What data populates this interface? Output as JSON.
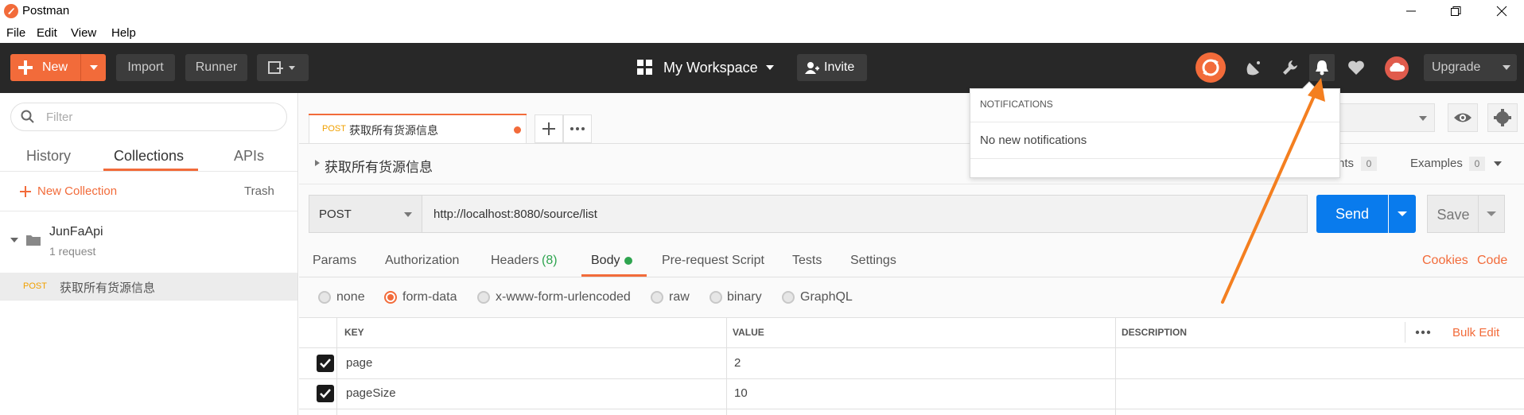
{
  "window": {
    "title": "Postman"
  },
  "menu": [
    "File",
    "Edit",
    "View",
    "Help"
  ],
  "header": {
    "new_label": "New",
    "import_label": "Import",
    "runner_label": "Runner",
    "workspace_label": "My Workspace",
    "invite_label": "Invite",
    "upgrade_label": "Upgrade"
  },
  "sidebar": {
    "filter_placeholder": "Filter",
    "tabs": [
      "History",
      "Collections",
      "APIs"
    ],
    "new_collection_label": "New Collection",
    "trash_label": "Trash",
    "collection": {
      "name": "JunFaApi",
      "count": "1 request"
    },
    "request": {
      "method": "POST",
      "name": "获取所有货源信息"
    }
  },
  "request_tab": {
    "method": "POST",
    "name": "获取所有货源信息"
  },
  "request": {
    "title": "获取所有货源信息",
    "comments_partial": "nts",
    "comments_count": "0",
    "examples_label": "Examples",
    "examples_count": "0",
    "method": "POST",
    "url": "http://localhost:8080/source/list",
    "send_label": "Send",
    "save_label": "Save"
  },
  "subtabs": {
    "params": "Params",
    "authorization": "Authorization",
    "headers": "Headers",
    "headers_count": "(8)",
    "body": "Body",
    "prerequest": "Pre-request Script",
    "tests": "Tests",
    "settings": "Settings",
    "cookies": "Cookies",
    "code": "Code"
  },
  "body_types": [
    "none",
    "form-data",
    "x-www-form-urlencoded",
    "raw",
    "binary",
    "GraphQL"
  ],
  "table": {
    "headers": {
      "key": "KEY",
      "value": "VALUE",
      "description": "DESCRIPTION",
      "bulk_edit": "Bulk Edit"
    },
    "rows": [
      {
        "key": "page",
        "value": "2",
        "checked": true
      },
      {
        "key": "pageSize",
        "value": "10",
        "checked": true
      }
    ]
  },
  "notifications": {
    "title": "NOTIFICATIONS",
    "empty": "No new notifications"
  },
  "colors": {
    "accent": "#f26b3a",
    "send_blue": "#097bed",
    "header_bg": "#282828",
    "annotation_arrow": "#f47f20"
  }
}
